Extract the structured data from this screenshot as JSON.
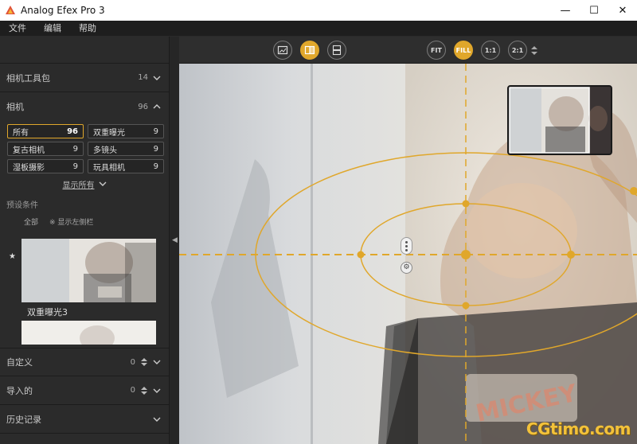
{
  "window": {
    "title": "Analog Efex Pro 3",
    "minimize": "—",
    "maximize": "☐",
    "close": "✕"
  },
  "menu": [
    "文件",
    "编辑",
    "帮助"
  ],
  "sidebar": {
    "sections": {
      "camera_kit": {
        "label": "相机工具包",
        "count": "14"
      },
      "camera": {
        "label": "相机",
        "count": "96"
      },
      "custom": {
        "label": "自定义",
        "count": "0"
      },
      "imported": {
        "label": "导入的",
        "count": "0"
      },
      "history": {
        "label": "历史记录"
      }
    },
    "presets": [
      {
        "label": "所有",
        "count": "96",
        "active": true
      },
      {
        "label": "双重曝光",
        "count": "9"
      },
      {
        "label": "复古相机",
        "count": "9"
      },
      {
        "label": "多镜头",
        "count": "9"
      },
      {
        "label": "湿板摄影",
        "count": "9"
      },
      {
        "label": "玩具相机",
        "count": "9"
      }
    ],
    "show_all": "显示所有",
    "preview_label": "双重曝光3",
    "hidden_label": "预设条件",
    "hidden_row": [
      "全部",
      "※ 显示左侧栏"
    ]
  },
  "toolbar": {
    "zoom": [
      "FIT",
      "FILL",
      "1:1",
      "2:1"
    ],
    "active_zoom": "FILL",
    "view_modes": [
      "single-view-icon",
      "split-view-icon",
      "side-by-side-icon"
    ],
    "active_view": "split-view-icon"
  },
  "watermark": {
    "brand": "CGTIMO",
    "site": "CGtimo.com"
  },
  "colors": {
    "accent": "#e0a72b",
    "panel": "#2b2b2b",
    "toolbar": "#2e2e2e"
  }
}
